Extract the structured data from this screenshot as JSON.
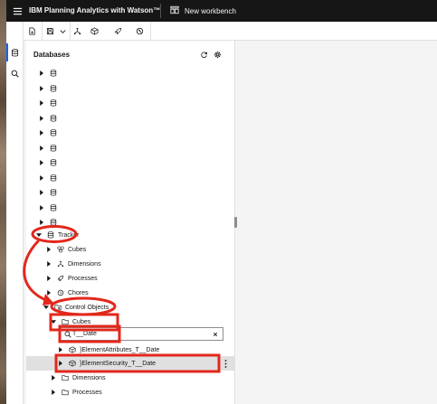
{
  "header": {
    "app_name": "IBM Planning Analytics with Watson™",
    "workbench_label": "New workbench"
  },
  "sidenav": {
    "items": [
      {
        "icon": "database-icon",
        "active": true
      },
      {
        "icon": "search-icon",
        "active": false
      }
    ]
  },
  "toolbar": {
    "items": [
      "new-file-icon",
      "save-icon",
      "chevron-down-icon",
      "hierarchy-icon",
      "cube-icon",
      "rocket-icon",
      "timer-icon"
    ]
  },
  "panel": {
    "title": "Databases",
    "header_icons": [
      "refresh-icon",
      "settings-icon"
    ]
  },
  "tree": {
    "unnamed_count": 11,
    "tracker": "Tracker",
    "cubes": "Cubes",
    "dimensions": "Dimensions",
    "processes": "Processes",
    "chores": "Chores",
    "control_objects": "Control Objects",
    "co_cubes": "Cubes",
    "filtered_item_1": "}ElementAttributes_T__Date",
    "filtered_item_2": "}ElementSecurity_T__Date",
    "co_dimensions": "Dimensions",
    "co_processes": "Processes"
  },
  "search": {
    "value": "T__Date",
    "placeholder": ""
  },
  "colors": {
    "top_bar": "#161616",
    "annotation": "#e3271b",
    "accent": "#0f62fe",
    "selected_row": "#e0e0e0"
  }
}
